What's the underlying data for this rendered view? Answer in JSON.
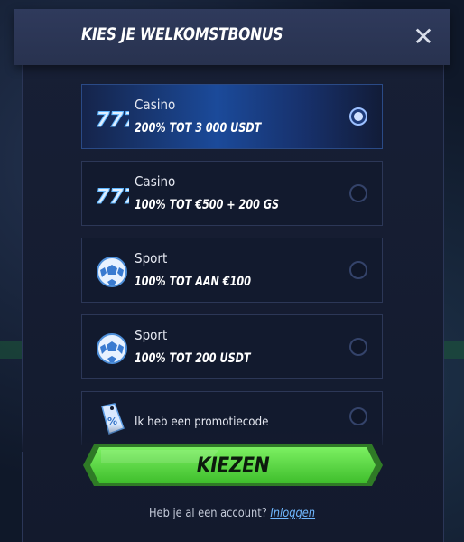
{
  "modal": {
    "title": "KIES JE WELKOMSTBONUS",
    "close_icon": "close-icon"
  },
  "options": [
    {
      "icon": "slot-777-icon",
      "category": "Casino",
      "offer": "200% TOT 3 000 USDT",
      "selected": true
    },
    {
      "icon": "slot-777-icon",
      "category": "Casino",
      "offer": "100% TOT €500 + 200 GS",
      "selected": false
    },
    {
      "icon": "soccer-ball-icon",
      "category": "Sport",
      "offer": "100% TOT AAN €100",
      "selected": false
    },
    {
      "icon": "soccer-ball-icon",
      "category": "Sport",
      "offer": "100% TOT 200 USDT",
      "selected": false
    },
    {
      "icon": "promo-tag-icon",
      "label": "Ik heb een promotiecode",
      "selected": false
    }
  ],
  "cta": {
    "label": "KIEZEN",
    "color": "#5fe046"
  },
  "footer": {
    "question": "Heb je al een account?",
    "link": "Inloggen"
  },
  "colors": {
    "accent_blue": "#1b4a9a",
    "link": "#6fb7ff",
    "button_green": "#5fe046"
  }
}
